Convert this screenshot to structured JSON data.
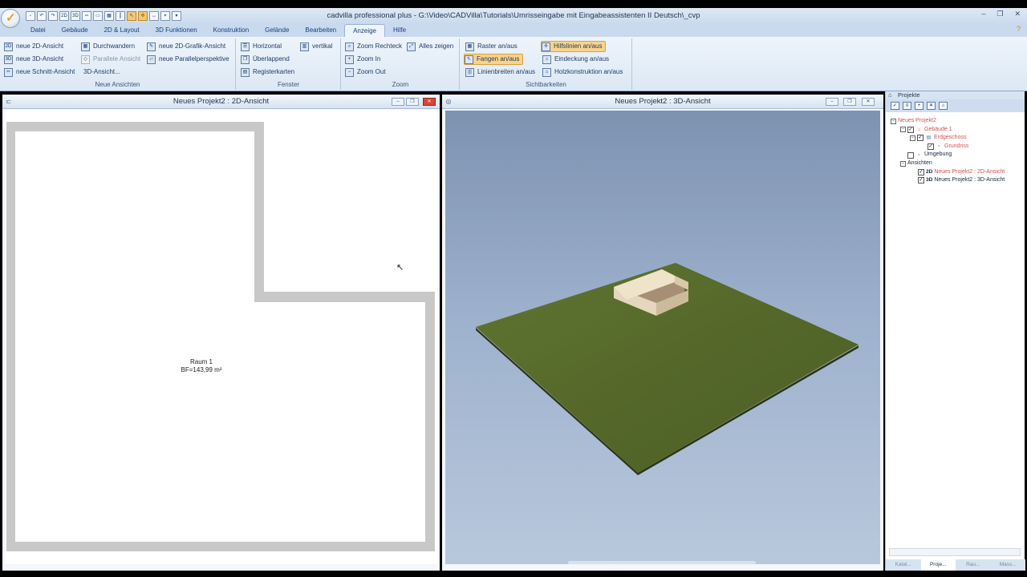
{
  "window": {
    "title": "cadvilla professional plus - G:\\Video\\CADVilla\\Tutorials\\Umrisseingabe mit Eingabeassistenten II Deutsch\\_cvp",
    "minimize": "–",
    "restore": "❐",
    "close": "✕"
  },
  "app_menu_icon": "app-logo-icon",
  "quick_access": [
    "new-file-icon",
    "undo-icon",
    "redo-icon",
    "2d-view-icon",
    "3d-view-icon",
    "wall-icon",
    "grid-icon",
    "pointer-icon",
    "snap-icon",
    "dimension-icon",
    "cursor-icon",
    "more-icon"
  ],
  "tabs": [
    "Datei",
    "Gebäude",
    "2D & Layout",
    "3D Funktionen",
    "Konstruktion",
    "Gelände",
    "Bearbeiten",
    "Anzeige",
    "Hilfe"
  ],
  "active_tab": "Anzeige",
  "ribbon": {
    "neue_ansichten": {
      "label": "Neue Ansichten",
      "items": [
        "neue 2D-Ansicht",
        "neue 3D-Ansicht",
        "neue Schnitt-Ansicht",
        "Durchwandern",
        "Parallele Ansicht",
        "3D-Ansicht...",
        "neue 2D-Grafik-Ansicht",
        "neue Parallelperspektive"
      ]
    },
    "fenster": {
      "label": "Fenster",
      "items": [
        "Horizontal",
        "Überlappend",
        "Registerkarten",
        "vertikal"
      ]
    },
    "zoom": {
      "label": "Zoom",
      "items": [
        "Zoom Rechteck",
        "Zoom In",
        "Zoom Out",
        "Alles zeigen"
      ]
    },
    "sichtbarkeiten": {
      "label": "Sichtbarkeiten",
      "items": [
        "Raster an/aus",
        "Fangen an/aus",
        "Linienbreiten an/aus",
        "Hilfslinien an/aus",
        "Eindeckung an/aus",
        "Holzkonstruktion an/aus"
      ]
    }
  },
  "view2d": {
    "title": "Neues Projekt2 : 2D-Ansicht",
    "room_name": "Raum 1",
    "room_area": "BF=143,99 m²"
  },
  "view3d": {
    "title": "Neues Projekt2 : 3D-Ansicht"
  },
  "projects": {
    "title": "Projekte",
    "tree": [
      {
        "label": "Neues Projekt2"
      },
      {
        "label": "Gebäude 1"
      },
      {
        "label": "Erdgeschoss"
      },
      {
        "label": "Grundriss"
      },
      {
        "label": "Umgebung"
      },
      {
        "label": "Ansichten"
      },
      {
        "label": "Neues Projekt2 : 2D-Ansicht"
      },
      {
        "label": "Neues Projekt2 : 3D-Ansicht"
      }
    ],
    "view_badges": [
      "2D",
      "3D"
    ],
    "bottom_tabs": [
      "Katal...",
      "Proje...",
      "Rau...",
      "Mass..."
    ]
  },
  "colors": {
    "accent": "#fad38a",
    "ribbon": "#dce8f5",
    "tree_red": "#d25050",
    "terrain": "#5a6e2c",
    "wall": "#c8c8c8",
    "sky": "#9db1cd"
  }
}
